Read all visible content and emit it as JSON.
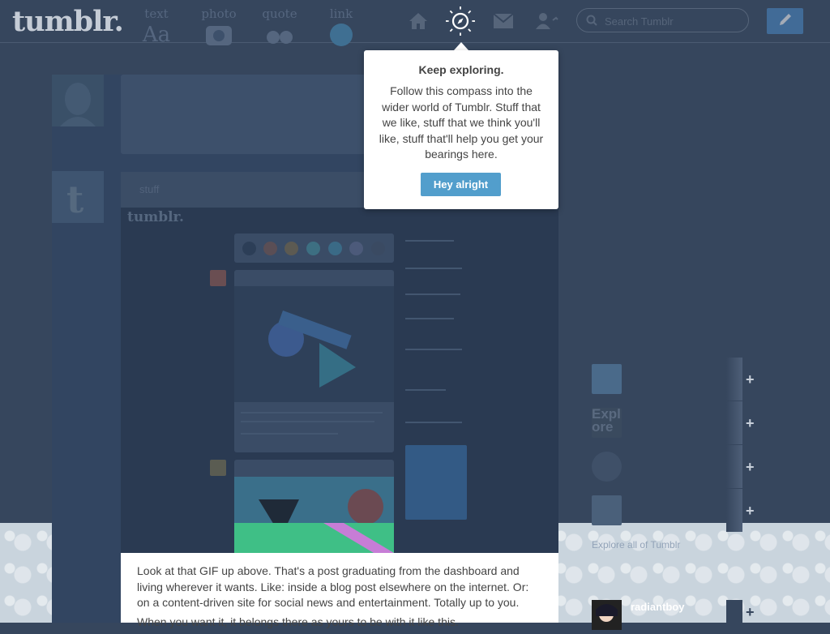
{
  "header": {
    "logo": "tumblr.",
    "search_placeholder": "Search Tumblr"
  },
  "post_form": {
    "types": [
      {
        "label": "text",
        "icon": "Aa"
      },
      {
        "label": "photo",
        "icon": "photo-icon"
      },
      {
        "label": "quote",
        "icon": "quote-icon"
      },
      {
        "label": "link",
        "icon": "link-icon"
      }
    ]
  },
  "post": {
    "header_text": "stuff",
    "gif_logo": "tumblr."
  },
  "tooltip": {
    "title": "Keep exploring.",
    "body": "Follow this compass into the wider world of Tumblr. Stuff that we like, stuff that we think you'll like, stuff that'll help you get your bearings here.",
    "button": "Hey alright"
  },
  "description": {
    "line1": "Look at that GIF up above. That's a post graduating from the dashboard and living wherever it wants. Like: inside a blog post elsewhere on the internet. Or: on a content-driven site for social news and entertainment. Totally up to you.",
    "line2": "When you want it, it belongs there as yours to be with it like this."
  },
  "sidebar": {
    "explore_link": "Explore all of Tumblr",
    "radar_user": "radiantboy",
    "recommendations": [
      "",
      "Explore",
      "",
      ""
    ]
  },
  "colors": {
    "background": "#36465d",
    "accent": "#529ecc",
    "compose": "#4a8ac8"
  }
}
